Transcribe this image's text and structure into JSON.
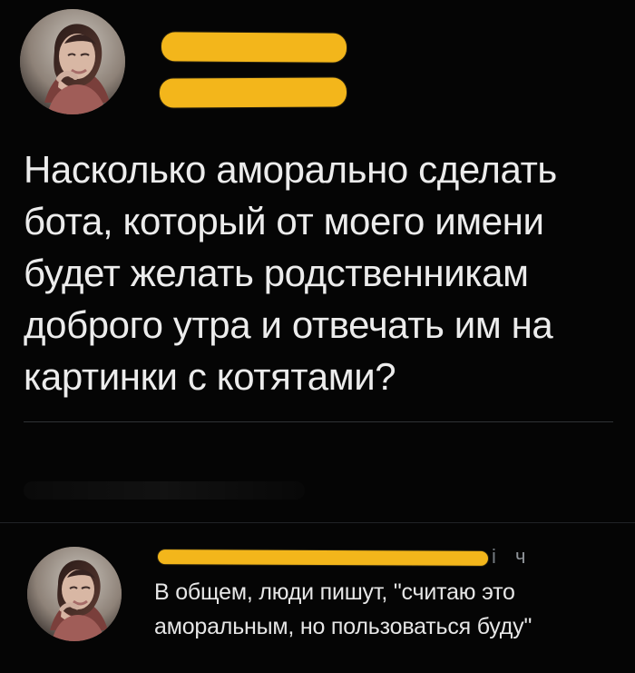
{
  "main_tweet": {
    "text": "Насколько аморально сделать\nбота, который от моего имени\nбудет желать родственникам\nдоброго утра и отвечать им на\nкартинки с котятами?"
  },
  "reply": {
    "handle_partial": "i",
    "time_partial": "ч",
    "text": "В общем, люди пишут, \"считаю это\nаморальным, но пользоваться буду\""
  },
  "colors": {
    "background": "#050505",
    "text": "#ececec",
    "muted": "#7d8287",
    "redaction": "#f3b61b",
    "divider": "#2f3336"
  },
  "icons": {
    "avatar_main": "woman-portrait-avatar",
    "avatar_reply": "woman-portrait-avatar"
  }
}
